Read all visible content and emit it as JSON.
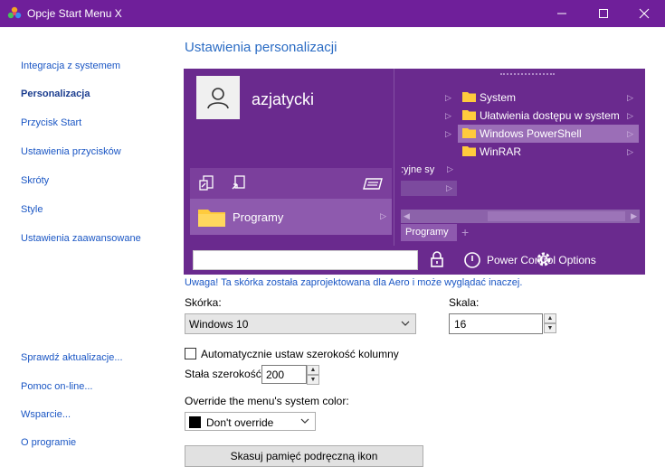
{
  "window": {
    "title": "Opcje Start Menu X"
  },
  "sidebar": {
    "items": [
      {
        "label": "Integracja z systemem"
      },
      {
        "label": "Personalizacja",
        "active": true
      },
      {
        "label": "Przycisk Start"
      },
      {
        "label": "Ustawienia przycisków"
      },
      {
        "label": "Skróty"
      },
      {
        "label": "Style"
      },
      {
        "label": "Ustawienia zaawansowane"
      }
    ],
    "bottom_items": [
      {
        "label": "Sprawdź aktualizacje..."
      },
      {
        "label": "Pomoc on-line..."
      },
      {
        "label": "Wsparcie..."
      },
      {
        "label": "O programie"
      }
    ]
  },
  "main": {
    "title": "Ustawienia personalizacji",
    "preview": {
      "username": "azjatycki",
      "programs_label": "Programy",
      "menu_items": [
        "System",
        "Ułatwienia dostępu w system",
        "Windows PowerShell",
        "WinRAR"
      ],
      "highlighted_item": "Windows PowerShell",
      "partial_item": ":yjne sy",
      "tab_label": "Programy",
      "power_label": "Power Control Options"
    },
    "warning": "Uwaga! Ta skórka została zaprojektowana dla Aero i może wyglądać inaczej.",
    "skin_label": "Skórka:",
    "skin_value": "Windows 10",
    "scale_label": "Skala:",
    "scale_value": "16",
    "auto_width_label": "Automatycznie ustaw szerokość kolumny",
    "auto_width_checked": false,
    "fixed_width_label": "Stała szerokość:",
    "fixed_width_value": "200",
    "override_label": "Override the menu's system color:",
    "override_value": "Don't override",
    "override_color": "#000000",
    "clear_cache_button": "Skasuj pamięć podręczną ikon"
  },
  "colors": {
    "titlebar": "#6f1f9a",
    "preview_bg": "#6a2a8e",
    "link": "#1a56c4",
    "folder": "#ffcb3d"
  }
}
